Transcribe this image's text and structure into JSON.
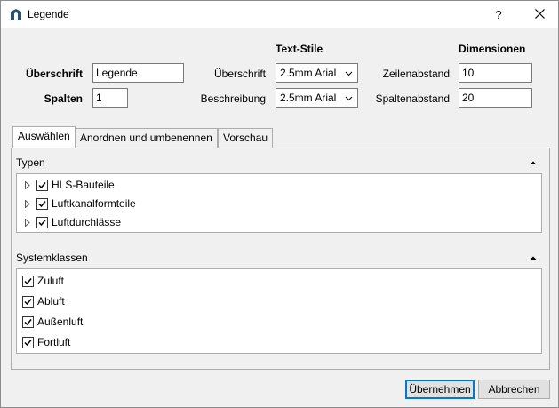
{
  "window": {
    "title": "Legende",
    "help_label": "?",
    "icons": {
      "app": "app-logo-icon",
      "close": "close-icon"
    }
  },
  "header": {
    "ueberschrift_label": "Überschrift",
    "ueberschrift_value": "Legende",
    "spalten_label": "Spalten",
    "spalten_value": "1",
    "textstile_heading": "Text-Stile",
    "textstile_ueberschrift_label": "Überschrift",
    "textstile_ueberschrift_value": "2.5mm Arial",
    "textstile_beschreibung_label": "Beschreibung",
    "textstile_beschreibung_value": "2.5mm Arial",
    "dimensionen_heading": "Dimensionen",
    "zeilenabstand_label": "Zeilenabstand",
    "zeilenabstand_value": "10",
    "spaltenabstand_label": "Spaltenabstand",
    "spaltenabstand_value": "20"
  },
  "tabs": [
    {
      "label": "Auswählen",
      "active": true
    },
    {
      "label": "Anordnen und umbenennen",
      "active": false
    },
    {
      "label": "Vorschau",
      "active": false
    }
  ],
  "typen": {
    "title": "Typen",
    "items": [
      {
        "label": "HLS-Bauteile",
        "checked": true,
        "expandable": true
      },
      {
        "label": "Luftkanalformteile",
        "checked": true,
        "expandable": true
      },
      {
        "label": "Luftdurchlässe",
        "checked": true,
        "expandable": true
      }
    ]
  },
  "systemklassen": {
    "title": "Systemklassen",
    "items": [
      {
        "label": "Zuluft",
        "checked": true
      },
      {
        "label": "Abluft",
        "checked": true
      },
      {
        "label": "Außenluft",
        "checked": true
      },
      {
        "label": "Fortluft",
        "checked": true
      }
    ]
  },
  "footer": {
    "apply_label": "Übernehmen",
    "cancel_label": "Abbrechen"
  },
  "colors": {
    "accent": "#0078d7",
    "window_bg": "#f0f0f0",
    "border": "#adadad"
  }
}
